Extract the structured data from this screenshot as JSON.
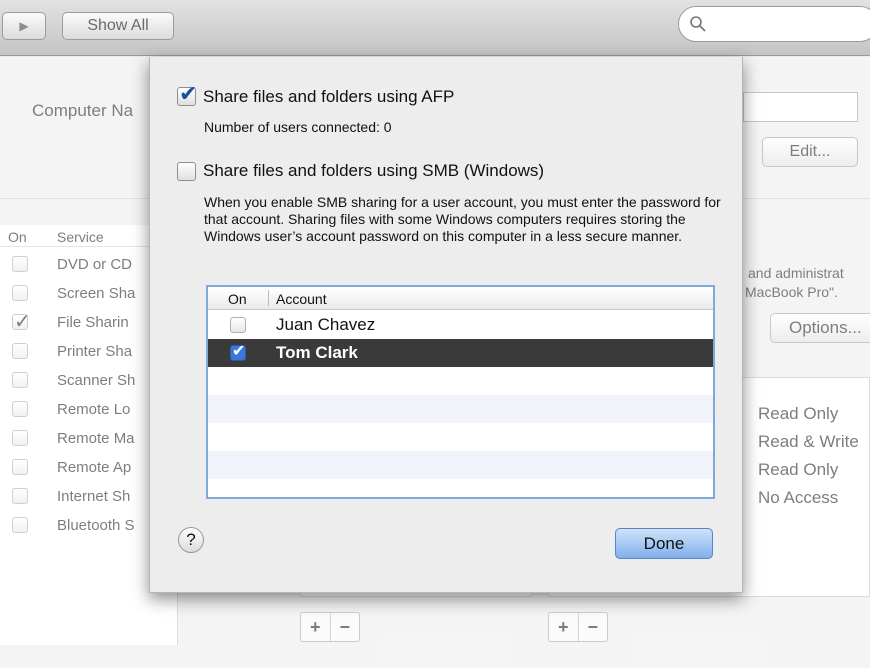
{
  "toolbar": {
    "forward_icon": "play-triangle-icon",
    "show_all_label": "Show All",
    "search_placeholder": ""
  },
  "background": {
    "computer_name_label": "Computer Na",
    "edit_button": "Edit...",
    "services_header_on": "On",
    "services_header_service": "Service",
    "services": [
      {
        "label": "DVD or CD",
        "checked": false
      },
      {
        "label": "Screen Sha",
        "checked": false
      },
      {
        "label": "File Sharin",
        "checked": true
      },
      {
        "label": "Printer Sha",
        "checked": false
      },
      {
        "label": "Scanner Sh",
        "checked": false
      },
      {
        "label": "Remote Lo",
        "checked": false
      },
      {
        "label": "Remote Ma",
        "checked": false
      },
      {
        "label": "Remote Ap",
        "checked": false
      },
      {
        "label": "Internet Sh",
        "checked": false
      },
      {
        "label": "Bluetooth S",
        "checked": false
      }
    ],
    "right_text_line1": "and administrat",
    "right_text_line2": "MacBook Pro\".",
    "options_button": "Options...",
    "permissions": [
      "Read Only",
      "Read & Write",
      "Read Only",
      "No Access"
    ],
    "plus_label": "+",
    "minus_label": "−"
  },
  "sheet": {
    "afp_label": "Share files and folders using AFP",
    "afp_checked": true,
    "users_connected": "Number of users connected: 0",
    "smb_label": "Share files and folders using SMB (Windows)",
    "smb_checked": false,
    "smb_description": "When you enable SMB sharing for a user account, you must enter the password for that account. Sharing files with some Windows computers requires storing the Windows user’s account password on this computer in a less secure manner.",
    "table_header_on": "On",
    "table_header_account": "Account",
    "accounts": [
      {
        "name": "Juan Chavez",
        "checked": false
      },
      {
        "name": "Tom Clark",
        "checked": true,
        "selected": true
      }
    ],
    "help_label": "?",
    "done_button": "Done"
  }
}
